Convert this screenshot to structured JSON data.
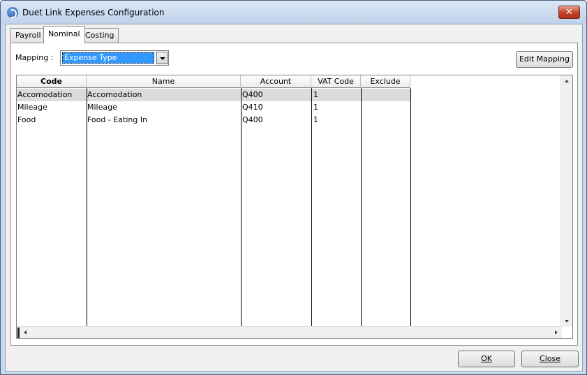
{
  "window": {
    "title": "Duet Link Expenses Configuration",
    "close_label": "✕"
  },
  "tabs": [
    {
      "label": "Payroll",
      "active": false
    },
    {
      "label": "Nominal",
      "active": true
    },
    {
      "label": "Costing",
      "active": false
    }
  ],
  "mapping": {
    "label": "Mapping :",
    "selected": "Expense Type"
  },
  "edit_mapping_label": "Edit Mapping",
  "grid": {
    "columns": [
      "Code",
      "Name",
      "Account",
      "VAT Code",
      "Exclude"
    ],
    "rows": [
      {
        "code": "Accomodation",
        "name": "Accomodation",
        "account": "Q400",
        "vat": "1",
        "exclude": ""
      },
      {
        "code": "Mileage",
        "name": "Mileage",
        "account": "Q410",
        "vat": "1",
        "exclude": ""
      },
      {
        "code": "Food",
        "name": "Food - Eating In",
        "account": "Q400",
        "vat": "1",
        "exclude": ""
      }
    ]
  },
  "footer": {
    "ok_label": "OK",
    "close_label": "Close"
  },
  "colors": {
    "selection": "#3399ff",
    "selected_row": "#dcdcdc",
    "title_close": "#c7432c"
  }
}
